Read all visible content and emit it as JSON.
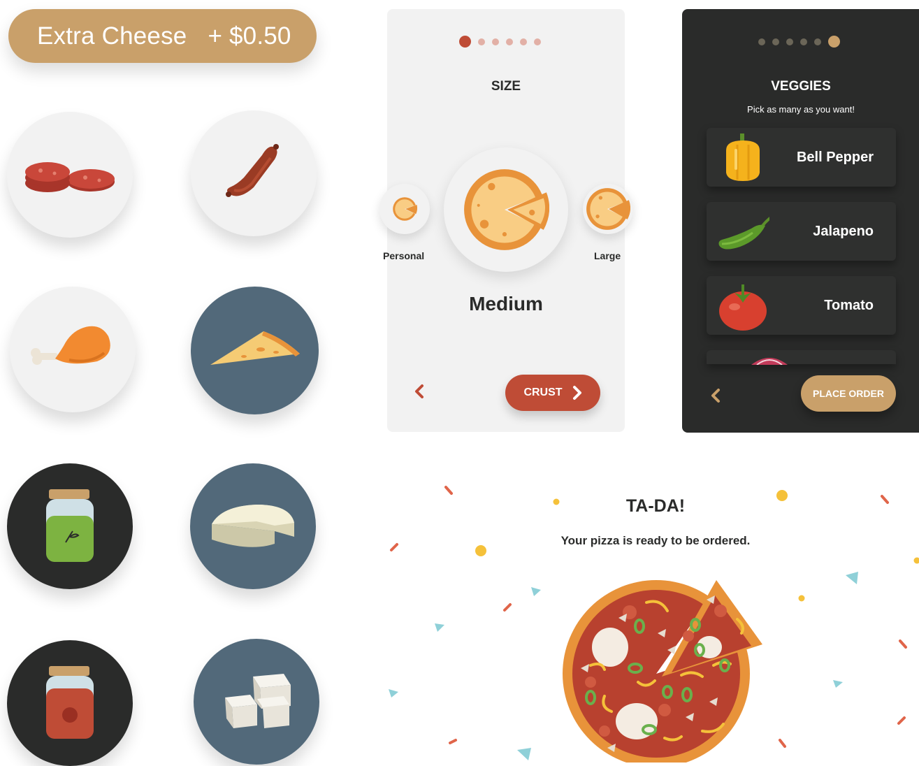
{
  "extra_topping": {
    "name": "Extra Cheese",
    "price": "+ $0.50"
  },
  "ingredients": [
    {
      "name": "pepperoni-icon"
    },
    {
      "name": "sausage-icon"
    },
    {
      "name": "chicken-icon"
    },
    {
      "name": "pizza-slice-icon"
    },
    {
      "name": "pesto-jar-icon"
    },
    {
      "name": "cheese-wheel-icon"
    },
    {
      "name": "tomato-sauce-jar-icon"
    },
    {
      "name": "tofu-icon"
    }
  ],
  "size_step": {
    "title": "SIZE",
    "step": 1,
    "total_steps": 6,
    "options": [
      "Personal",
      "Medium",
      "Large"
    ],
    "selected": "Medium",
    "next_label": "CRUST",
    "back_icon": "chevron-left-icon",
    "next_icon": "chevron-right-icon"
  },
  "veggies_step": {
    "title": "VEGGIES",
    "subtitle": "Pick as many as you want!",
    "step": 6,
    "total_steps": 6,
    "items": [
      "Bell Pepper",
      "Jalapeno",
      "Tomato"
    ],
    "action_label": "PLACE ORDER",
    "back_icon": "chevron-left-icon"
  },
  "confirmation": {
    "title": "TA-DA!",
    "subtitle": "Your pizza is ready to be ordered."
  },
  "colors": {
    "accent_red": "#bf4c36",
    "accent_gold": "#c9a06a",
    "dark": "#2a2b2a",
    "slate": "#52697a",
    "light": "#f2f2f2"
  }
}
